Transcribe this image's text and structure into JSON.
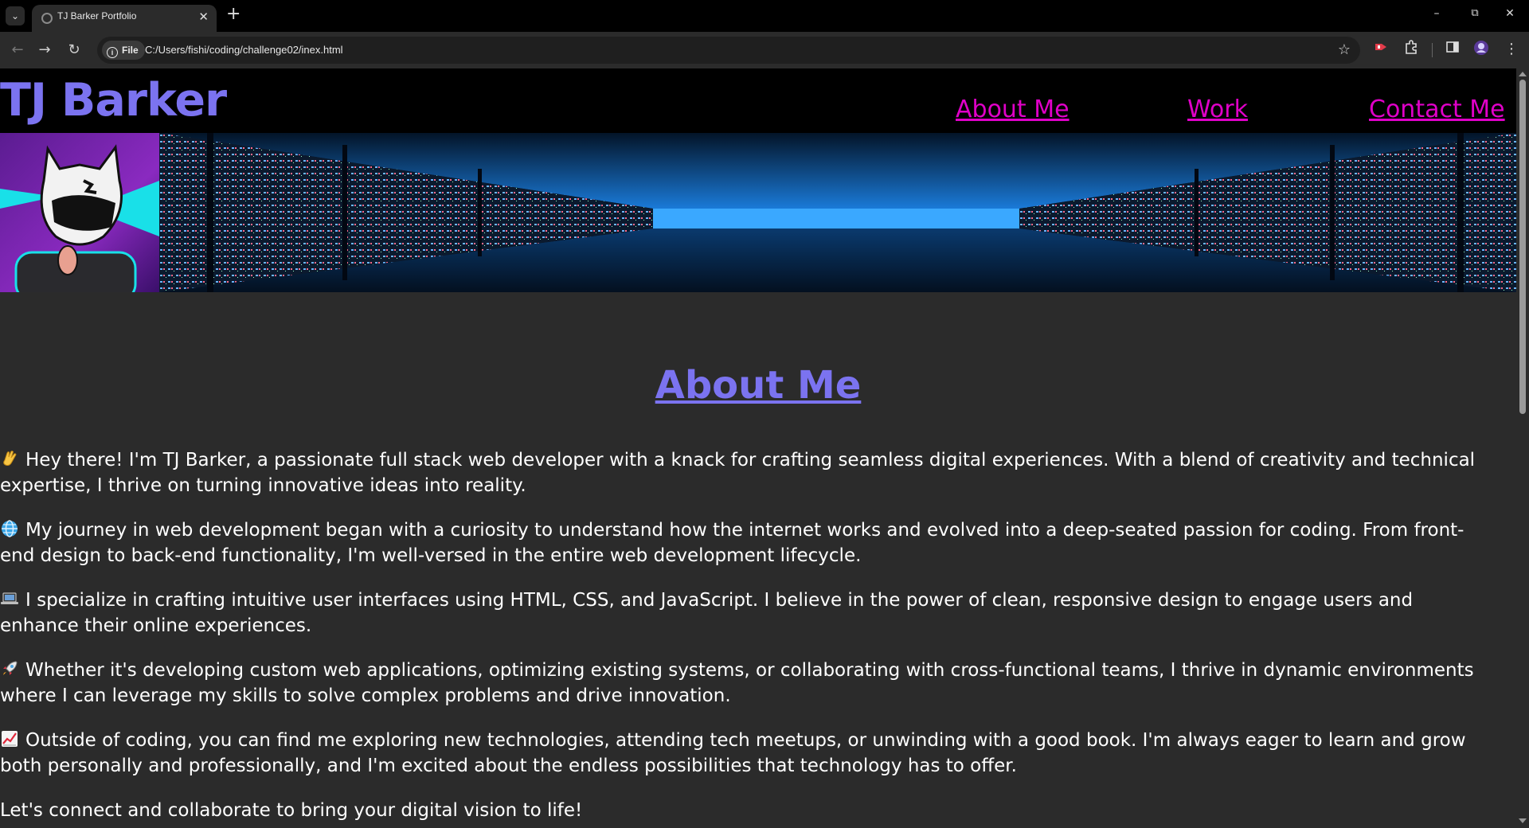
{
  "browser": {
    "tab_title": "TJ Barker Portfolio",
    "url_scheme_label": "File",
    "url": "C:/Users/fishi/coding/challenge02/inex.html"
  },
  "site": {
    "title": "TJ Barker",
    "nav": [
      {
        "label": "About Me"
      },
      {
        "label": "Work"
      },
      {
        "label": "Contact Me"
      }
    ]
  },
  "about": {
    "heading": "About Me",
    "paragraphs": [
      {
        "emoji": "waving-hand-icon",
        "text": "Hey there! I'm TJ Barker, a passionate full stack web developer with a knack for crafting seamless digital experiences. With a blend of creativity and technical expertise, I thrive on turning innovative ideas into reality."
      },
      {
        "emoji": "globe-icon",
        "text": "My journey in web development began with a curiosity to understand how the internet works and evolved into a deep-seated passion for coding. From front-end design to back-end functionality, I'm well-versed in the entire web development lifecycle."
      },
      {
        "emoji": "laptop-icon",
        "text": "I specialize in crafting intuitive user interfaces using HTML, CSS, and JavaScript. I believe in the power of clean, responsive design to engage users and enhance their online experiences."
      },
      {
        "emoji": "rocket-icon",
        "text": "Whether it's developing custom web applications, optimizing existing systems, or collaborating with cross-functional teams, I thrive in dynamic environments where I can leverage my skills to solve complex problems and drive innovation."
      },
      {
        "emoji": "chart-increasing-icon",
        "text": "Outside of coding, you can find me exploring new technologies, attending tech meetups, or unwinding with a good book. I'm always eager to learn and grow both personally and professionally, and I'm excited about the endless possibilities that technology has to offer."
      },
      {
        "emoji": "",
        "text": "Let's connect and collaborate to bring your digital vision to life!"
      }
    ]
  },
  "colors": {
    "title_purple": "#7b73f0",
    "nav_magenta": "#e000c8",
    "page_bg": "#2b2b2b",
    "header_bg": "#000000"
  }
}
